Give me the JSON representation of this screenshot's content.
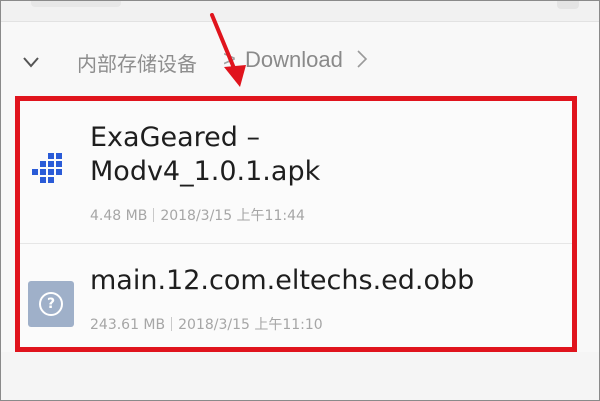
{
  "breadcrumb": {
    "root": "内部存储设备",
    "separator": ">",
    "current": "Download"
  },
  "files": [
    {
      "name_line1": "ExaGeared –",
      "name_line2": "Modv4_1.0.1.apk",
      "size": "4.48 MB",
      "date": "2018/3/15 上午11:44",
      "icon": "apk-app-icon"
    },
    {
      "name_line1": "main.12.com.eltechs.ed.obb",
      "size": "243.61 MB",
      "date": "2018/3/15 上午11:10",
      "icon": "unknown-file-icon",
      "icon_glyph": "?"
    }
  ],
  "colors": {
    "highlight": "#e0141d",
    "apk_icon": "#2a5bd7",
    "unknown_icon": "#9fb0c9"
  }
}
